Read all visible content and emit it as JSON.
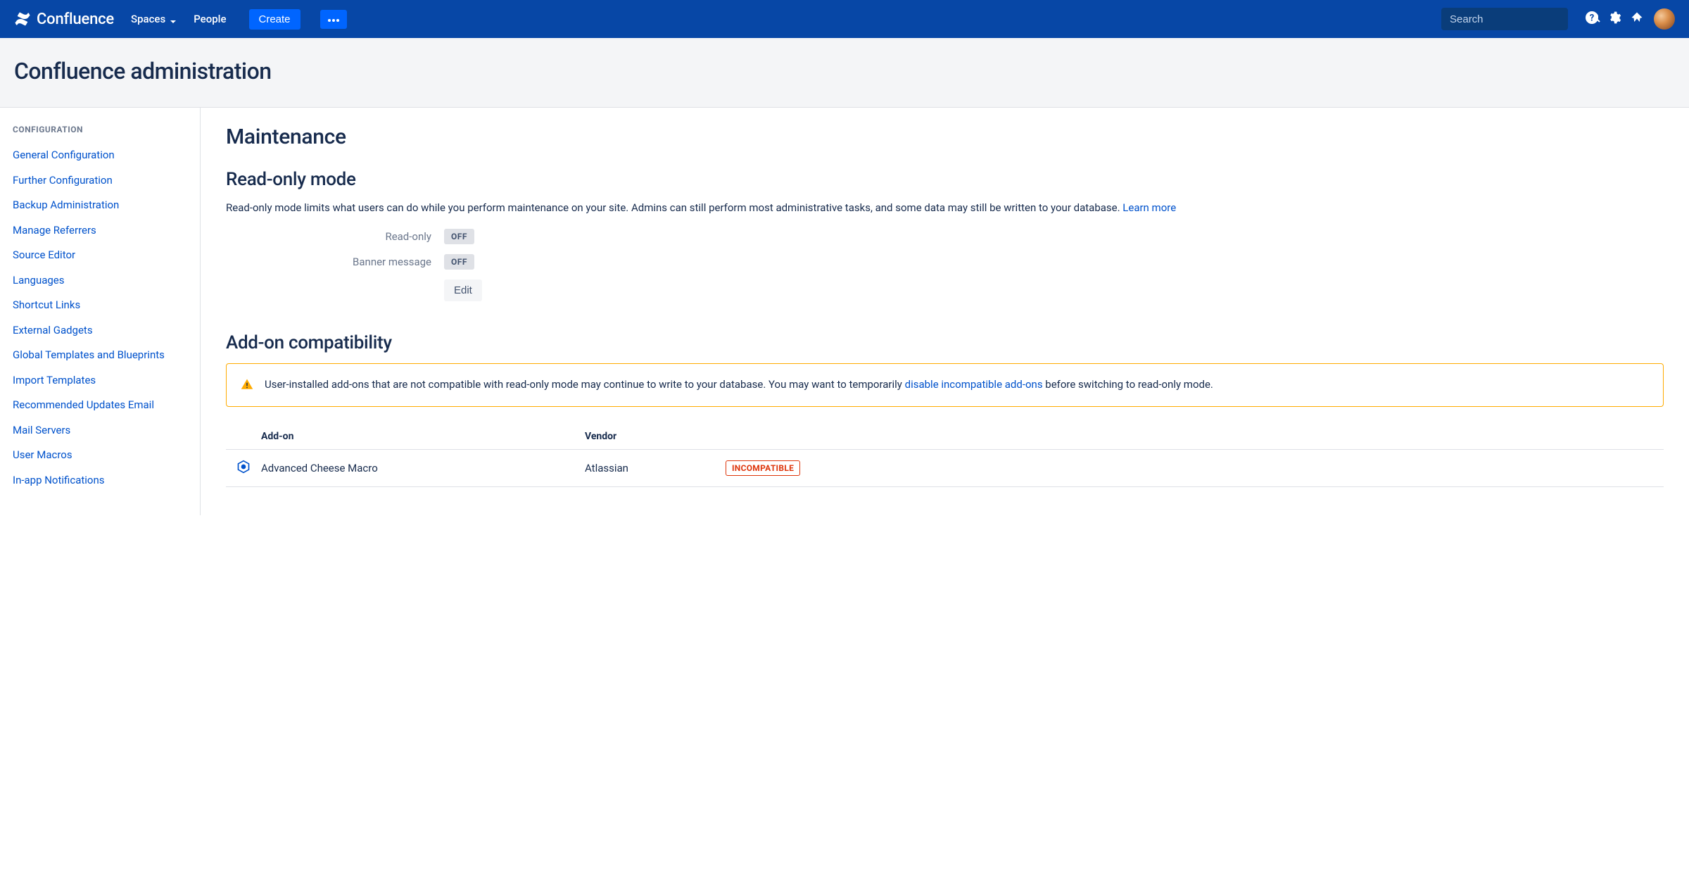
{
  "topnav": {
    "product": "Confluence",
    "items": [
      {
        "label": "Spaces",
        "has_dropdown": true
      },
      {
        "label": "People",
        "has_dropdown": false
      }
    ],
    "create_label": "Create",
    "search_placeholder": "Search"
  },
  "page": {
    "title": "Confluence administration"
  },
  "sidebar": {
    "section_title": "Configuration",
    "items": [
      "General Configuration",
      "Further Configuration",
      "Backup Administration",
      "Manage Referrers",
      "Source Editor",
      "Languages",
      "Shortcut Links",
      "External Gadgets",
      "Global Templates and Blueprints",
      "Import Templates",
      "Recommended Updates Email",
      "Mail Servers",
      "User Macros",
      "In-app Notifications"
    ]
  },
  "main": {
    "title": "Maintenance",
    "readonly": {
      "heading": "Read-only mode",
      "desc_pre": "Read-only mode limits what users can do while you perform maintenance on your site. Admins can still perform most administrative tasks, and some data may still be written to your database. ",
      "learn_more": "Learn more",
      "row1_label": "Read-only",
      "row1_value": "OFF",
      "row2_label": "Banner message",
      "row2_value": "OFF",
      "edit_label": "Edit"
    },
    "compat": {
      "heading": "Add-on compatibility",
      "warning_pre": "User-installed add-ons that are not compatible with read-only mode may continue to write to your database. You may want to temporarily ",
      "warning_link": "disable incompatible add-ons",
      "warning_post": " before switching to read-only mode.",
      "columns": {
        "addon": "Add-on",
        "vendor": "Vendor"
      },
      "rows": [
        {
          "name": "Advanced Cheese Macro",
          "vendor": "Atlassian",
          "status": "INCOMPATIBLE"
        }
      ]
    }
  }
}
